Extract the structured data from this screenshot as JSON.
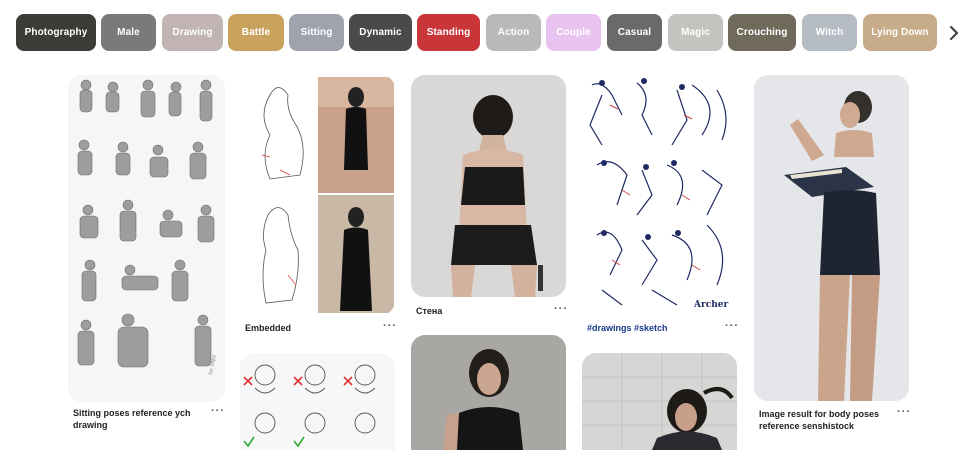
{
  "filters": [
    {
      "label": "Photography",
      "color": "#3c3b38"
    },
    {
      "label": "Male",
      "color": "#7a7a7c"
    },
    {
      "label": "Drawing",
      "color": "#c1b4b2"
    },
    {
      "label": "Battle",
      "color": "#c9a35e"
    },
    {
      "label": "Sitting",
      "color": "#9ea3ae"
    },
    {
      "label": "Dynamic",
      "color": "#4a4a48"
    },
    {
      "label": "Standing",
      "color": "#c8363a"
    },
    {
      "label": "Action",
      "color": "#b9b9b9"
    },
    {
      "label": "Couple",
      "color": "#e9c3f0"
    },
    {
      "label": "Casual",
      "color": "#6a6a68"
    },
    {
      "label": "Magic",
      "color": "#c4c3c0"
    },
    {
      "label": "Crouching",
      "color": "#706a5c"
    },
    {
      "label": "Witch",
      "color": "#b6bcc4"
    },
    {
      "label": "Lying Down",
      "color": "#c8ab88"
    }
  ],
  "scroll_icon": "chevron-right-icon",
  "pins": [
    {
      "id": "p1",
      "title": "Sitting poses reference ych drawing",
      "more": "···",
      "icon": "ellipsis-icon"
    },
    {
      "id": "p2",
      "title": "Embedded",
      "more": "···",
      "icon": "ellipsis-icon"
    },
    {
      "id": "p3",
      "title": "Стена",
      "more": "···",
      "icon": "ellipsis-icon"
    },
    {
      "id": "p4",
      "title": "#drawings #sketch",
      "more": "···",
      "icon": "ellipsis-icon"
    },
    {
      "id": "p5",
      "title": "Image result for body poses reference senshistock",
      "more": "···",
      "icon": "ellipsis-icon"
    }
  ],
  "image_text": {
    "archer_caption": "Archer",
    "copy_watermark": "for copy"
  },
  "colors": {
    "title_link": "#1a3a8a",
    "title_text": "#222222"
  }
}
